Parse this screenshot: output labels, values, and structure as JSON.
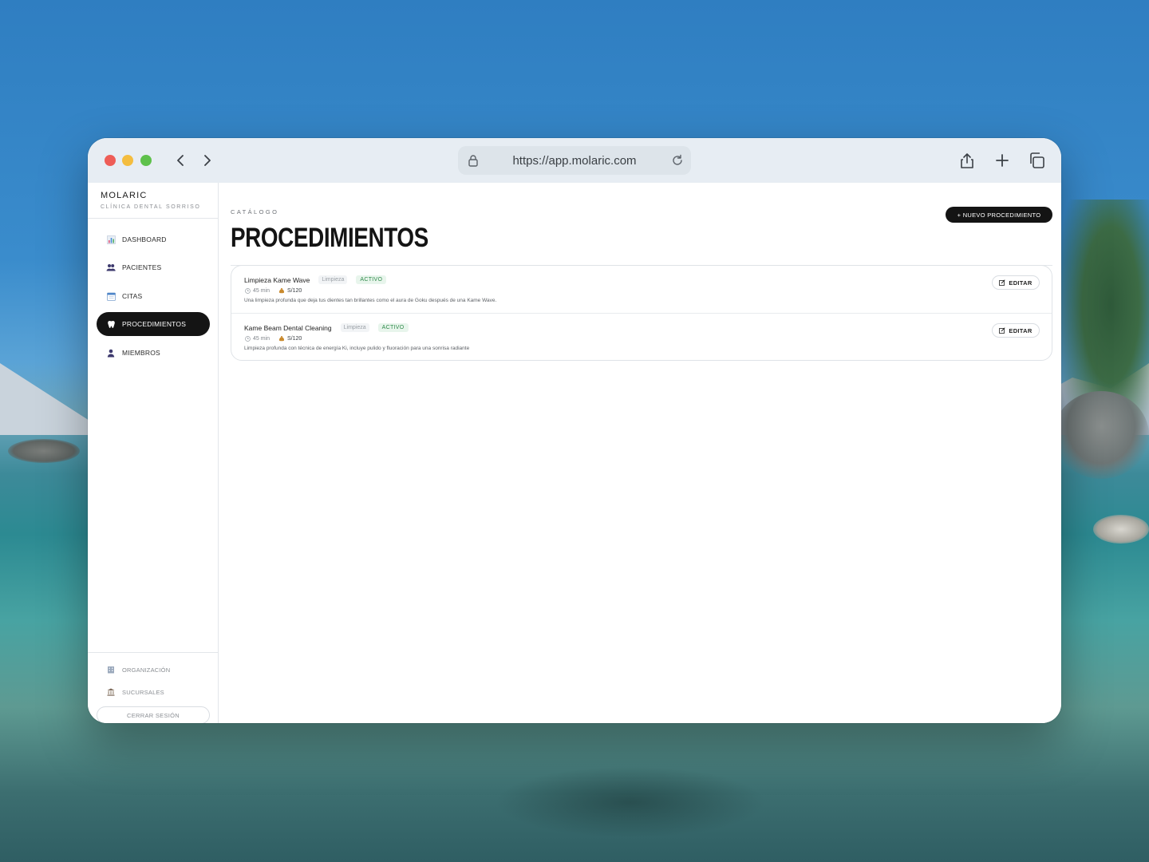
{
  "browser": {
    "url": "https://app.molaric.com"
  },
  "brand": {
    "name": "MOLARIC",
    "subtitle": "CLÍNICA DENTAL SORRISO"
  },
  "sidebar": {
    "items": [
      {
        "label": "DASHBOARD",
        "icon": "bar-chart-icon",
        "active": false
      },
      {
        "label": "PACIENTES",
        "icon": "people-icon",
        "active": false
      },
      {
        "label": "CITAS",
        "icon": "calendar-icon",
        "active": false
      },
      {
        "label": "PROCEDIMIENTOS",
        "icon": "tooth-icon",
        "active": true
      },
      {
        "label": "MIEMBROS",
        "icon": "person-icon",
        "active": false
      }
    ],
    "bottom": [
      {
        "label": "ORGANIZACIÓN",
        "icon": "building-icon"
      },
      {
        "label": "SUCURSALES",
        "icon": "bank-icon"
      }
    ],
    "logout_label": "CERRAR SESIÓN"
  },
  "main": {
    "eyebrow": "CATÁLOGO",
    "title": "PROCEDIMIENTOS",
    "new_button_label": "+ NUEVO PROCEDIMIENTO",
    "procedures": [
      {
        "name": "Limpieza Kame Wave",
        "category": "Limpieza",
        "status": "ACTIVO",
        "duration": "45 min",
        "price": "S/120",
        "description": "Una limpieza profunda que deja tus dientes tan brillantes como el aura de Goku después de una Kame Wave.",
        "edit_label": "EDITAR"
      },
      {
        "name": "Kame Beam Dental Cleaning",
        "category": "Limpieza",
        "status": "ACTIVO",
        "duration": "45 min",
        "price": "S/120",
        "description": "Limpieza profunda con técnica de energía Ki, incluye pulido y fluoración para una sonrisa radiante",
        "edit_label": "EDITAR"
      }
    ]
  },
  "colors": {
    "accent": "#141414",
    "status_active": "#2f8a4a"
  }
}
